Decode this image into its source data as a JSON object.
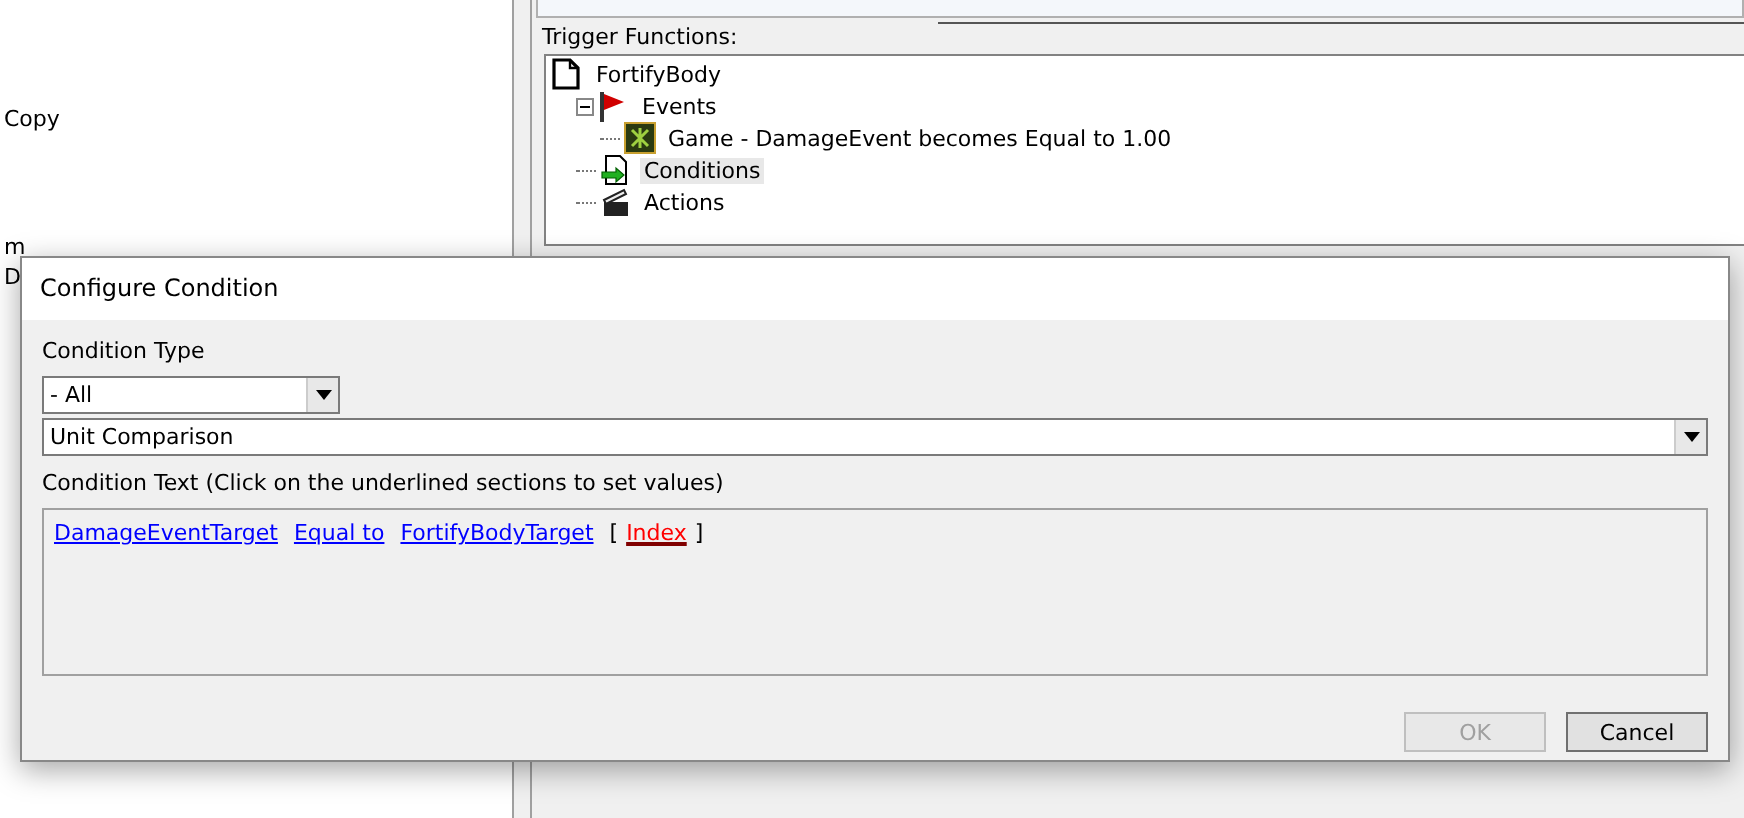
{
  "left_panel": {
    "fragments": [
      "Copy",
      "m",
      "D"
    ]
  },
  "trigger_functions": {
    "label": "Trigger Functions:",
    "tree": [
      {
        "label": "FortifyBody",
        "kind": "trigger",
        "selected": false,
        "children": [
          {
            "label": "Events",
            "kind": "events",
            "selected": false,
            "expanded": true,
            "children": [
              {
                "label": "Game - DamageEvent becomes Equal to 1.00",
                "kind": "game",
                "selected": false
              }
            ]
          },
          {
            "label": "Conditions",
            "kind": "conditions",
            "selected": true
          },
          {
            "label": "Actions",
            "kind": "actions",
            "selected": false
          }
        ]
      }
    ]
  },
  "dialog": {
    "title": "Configure Condition",
    "condition_type_label": "Condition Type",
    "category": "- All",
    "condition": "Unit Comparison",
    "text_label": "Condition Text (Click on the underlined sections to set values)",
    "condition_text": [
      {
        "text": "DamageEventTarget",
        "kind": "link"
      },
      {
        "text": "Equal to",
        "kind": "link"
      },
      {
        "text": "FortifyBodyTarget",
        "kind": "link"
      },
      {
        "text": "[",
        "kind": "plain"
      },
      {
        "text": "Index",
        "kind": "missing"
      },
      {
        "text": "]",
        "kind": "plain"
      }
    ],
    "buttons": [
      {
        "label": "OK",
        "disabled": true
      },
      {
        "label": "Cancel",
        "disabled": false
      }
    ]
  }
}
